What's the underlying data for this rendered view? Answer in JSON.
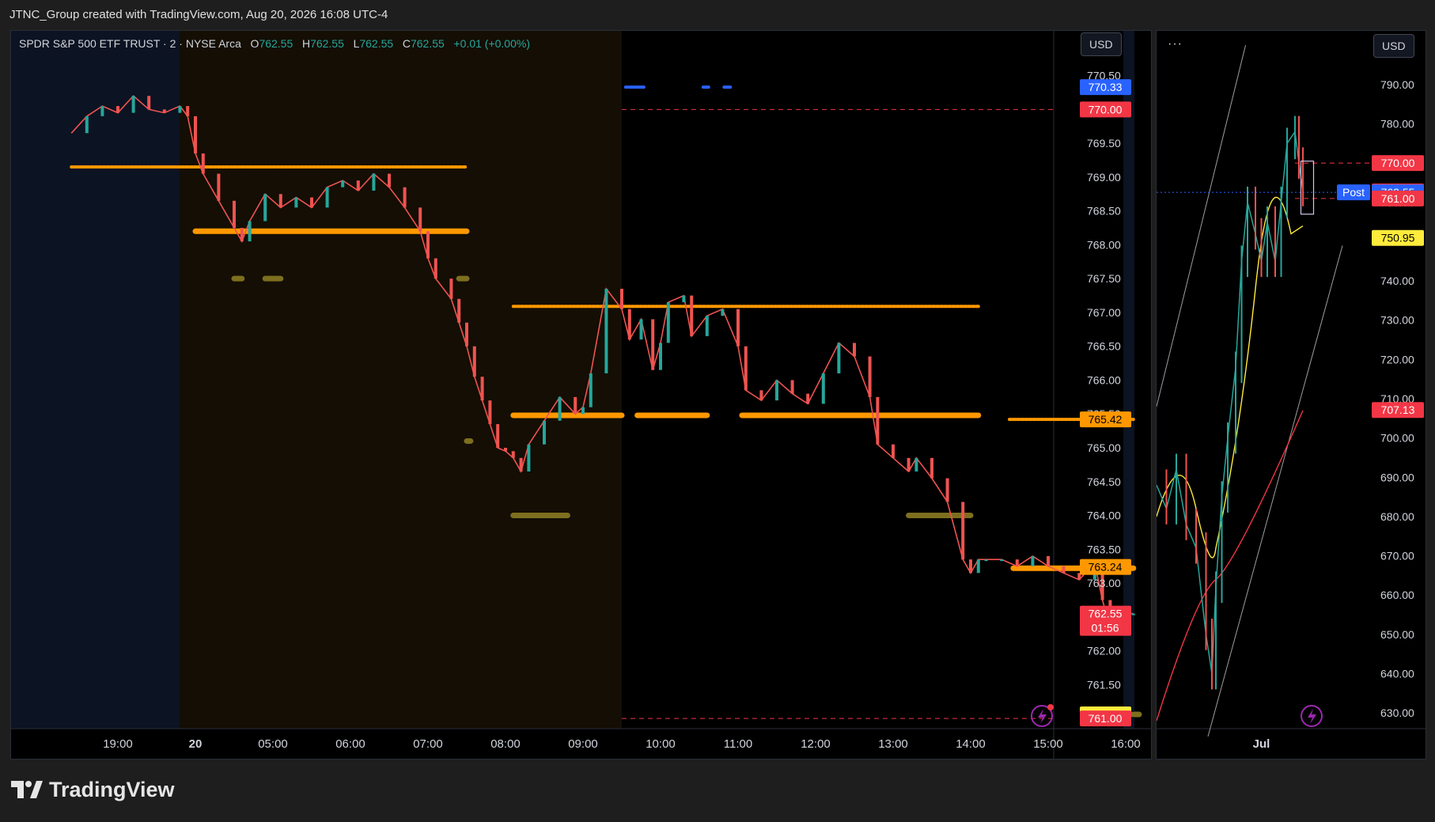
{
  "header": {
    "caption": "JTNC_Group created with TradingView.com, Aug 20, 2026 16:08 UTC-4"
  },
  "main_chart": {
    "symbol": "SPDR S&P 500 ETF TRUST · 2 · NYSE Arca",
    "ohlc": {
      "o_label": "O",
      "o": "762.55",
      "h_label": "H",
      "h": "762.55",
      "l_label": "L",
      "l": "762.55",
      "c_label": "C",
      "c": "762.55",
      "change": "+0.01 (+0.00%)"
    },
    "currency": "USD"
  },
  "side_chart": {
    "menu": "···",
    "currency": "USD"
  },
  "footer": {
    "brand": "TradingView"
  },
  "colors": {
    "up": "#26a69a",
    "down": "#ef5350",
    "orange": "#ff9800",
    "olive": "#7d6f1e",
    "blue": "#2962ff",
    "red_label": "#f23645",
    "yellow_label": "#ffeb3b"
  },
  "chart_data": [
    {
      "type": "line",
      "title": "",
      "ylim": [
        760.85,
        770.6
      ],
      "y_ticks": [
        "770.50",
        "770.00",
        "769.50",
        "769.00",
        "768.50",
        "768.00",
        "767.50",
        "767.00",
        "766.50",
        "766.00",
        "765.50",
        "765.00",
        "764.50",
        "764.00",
        "763.50",
        "763.00",
        "762.50",
        "762.00",
        "761.50",
        "761.00"
      ],
      "x_ticks": [
        {
          "label": "19:00",
          "t": -5.0
        },
        {
          "label": "20",
          "t": -4.0
        },
        {
          "label": "05:00",
          "t": -3.0
        },
        {
          "label": "06:00",
          "t": -2.0
        },
        {
          "label": "07:00",
          "t": -1.0
        },
        {
          "label": "08:00",
          "t": 0.0
        },
        {
          "label": "09:00",
          "t": 1.0
        },
        {
          "label": "10:00",
          "t": 2.0
        },
        {
          "label": "11:00",
          "t": 3.0
        },
        {
          "label": "12:00",
          "t": 4.0
        },
        {
          "label": "13:00",
          "t": 5.0
        },
        {
          "label": "14:00",
          "t": 6.0
        },
        {
          "label": "15:00",
          "t": 7.0
        },
        {
          "label": "16:00",
          "t": 8.0
        }
      ],
      "series": [
        {
          "x": [
            -5.6,
            -5.4,
            -5.2,
            -5.0,
            -4.8,
            -4.6,
            -4.4,
            -4.2,
            -4.1,
            -4.0,
            -3.9,
            -3.7,
            -3.5,
            -3.4,
            -3.3,
            -3.1,
            -2.9,
            -2.7,
            -2.5,
            -2.3,
            -2.1,
            -1.9,
            -1.7,
            -1.5,
            -1.3,
            -1.1,
            -1.0,
            -0.9,
            -0.7,
            -0.6,
            -0.5,
            -0.4,
            -0.3,
            -0.2,
            -0.1,
            0.0,
            0.1,
            0.2,
            0.3,
            0.5,
            0.7,
            0.9,
            1.0,
            1.1,
            1.3,
            1.5,
            1.6,
            1.75,
            1.9,
            2.0,
            2.1,
            2.3,
            2.4,
            2.6,
            2.8,
            3.0,
            3.1,
            3.3,
            3.5,
            3.7,
            3.9,
            4.1,
            4.3,
            4.5,
            4.7,
            4.8,
            5.0,
            5.2,
            5.3,
            5.5,
            5.7,
            5.9,
            6.0,
            6.1,
            6.2,
            6.4,
            6.6,
            6.8,
            7.0,
            7.2,
            7.4,
            7.6,
            7.7,
            7.8,
            7.85,
            7.95,
            8.0,
            8.1
          ],
          "y": [
            769.65,
            769.9,
            770.05,
            769.95,
            770.2,
            770.0,
            769.95,
            770.05,
            769.9,
            769.35,
            769.05,
            768.65,
            768.25,
            768.05,
            768.35,
            768.75,
            768.55,
            768.7,
            768.55,
            768.85,
            768.95,
            768.8,
            769.05,
            768.85,
            768.55,
            768.2,
            767.8,
            767.5,
            767.2,
            766.85,
            766.5,
            766.05,
            765.7,
            765.35,
            765.0,
            764.95,
            764.85,
            764.65,
            765.05,
            765.4,
            765.75,
            765.5,
            765.6,
            766.1,
            767.35,
            767.05,
            766.6,
            766.9,
            766.15,
            766.55,
            767.15,
            767.25,
            766.65,
            766.95,
            767.05,
            766.5,
            765.85,
            765.7,
            766.0,
            765.8,
            765.65,
            766.1,
            766.55,
            766.35,
            765.75,
            765.05,
            764.85,
            764.65,
            764.85,
            764.55,
            764.2,
            763.35,
            763.15,
            763.35,
            763.35,
            763.35,
            763.25,
            763.4,
            763.25,
            763.15,
            763.05,
            763.3,
            762.75,
            762.35,
            762.65,
            762.6,
            762.55,
            762.55
          ]
        }
      ],
      "levels": [
        {
          "value": 770.33,
          "label": "770.33",
          "color": "#2962ff"
        },
        {
          "value": 770.0,
          "label": "770.00",
          "color": "#f23645"
        },
        {
          "value": 765.42,
          "label": "765.42",
          "color": "#ff9800"
        },
        {
          "value": 763.24,
          "label": "763.24",
          "color": "#ff9800"
        },
        {
          "value": 762.55,
          "label": "762.55",
          "sublabel": "01:56",
          "color": "#f23645"
        },
        {
          "value": 761.06,
          "label": "761.06",
          "color": "#ffeb3b"
        },
        {
          "value": 761.0,
          "label": "761.00",
          "color": "#f23645"
        }
      ]
    },
    {
      "type": "line",
      "title": "",
      "ylim": [
        626,
        794
      ],
      "y_ticks": [
        "790.00",
        "780.00",
        "770.00",
        "760.00",
        "750.00",
        "740.00",
        "730.00",
        "720.00",
        "710.00",
        "700.00",
        "690.00",
        "680.00",
        "670.00",
        "660.00",
        "650.00",
        "640.00",
        "630.00"
      ],
      "x_ticks": [
        {
          "label": "Jul",
          "t": 0.53
        }
      ],
      "series": [
        {
          "name": "",
          "x": [
            0.0,
            0.05,
            0.1,
            0.15,
            0.2,
            0.25,
            0.28,
            0.3,
            0.33,
            0.36,
            0.4,
            0.43,
            0.46,
            0.5,
            0.53,
            0.56,
            0.6,
            0.63,
            0.66,
            0.7,
            0.72,
            0.74
          ],
          "y": [
            688,
            682,
            692,
            678,
            672,
            650,
            640,
            662,
            685,
            700,
            718,
            745,
            760,
            752,
            745,
            755,
            745,
            760,
            775,
            778,
            770,
            763
          ]
        }
      ],
      "levels": [
        {
          "value": 770.0,
          "label": "770.00",
          "color": "#f23645"
        },
        {
          "value": 762.78,
          "label": "762.78",
          "color": "#f23645"
        },
        {
          "value": 762.55,
          "label": "762.55",
          "color": "#2962ff",
          "tag": "Post"
        },
        {
          "value": 761.0,
          "label": "761.00",
          "color": "#f23645"
        },
        {
          "value": 750.95,
          "label": "750.95",
          "color": "#ffeb3b"
        },
        {
          "value": 707.13,
          "label": "707.13",
          "color": "#f23645"
        }
      ]
    }
  ]
}
